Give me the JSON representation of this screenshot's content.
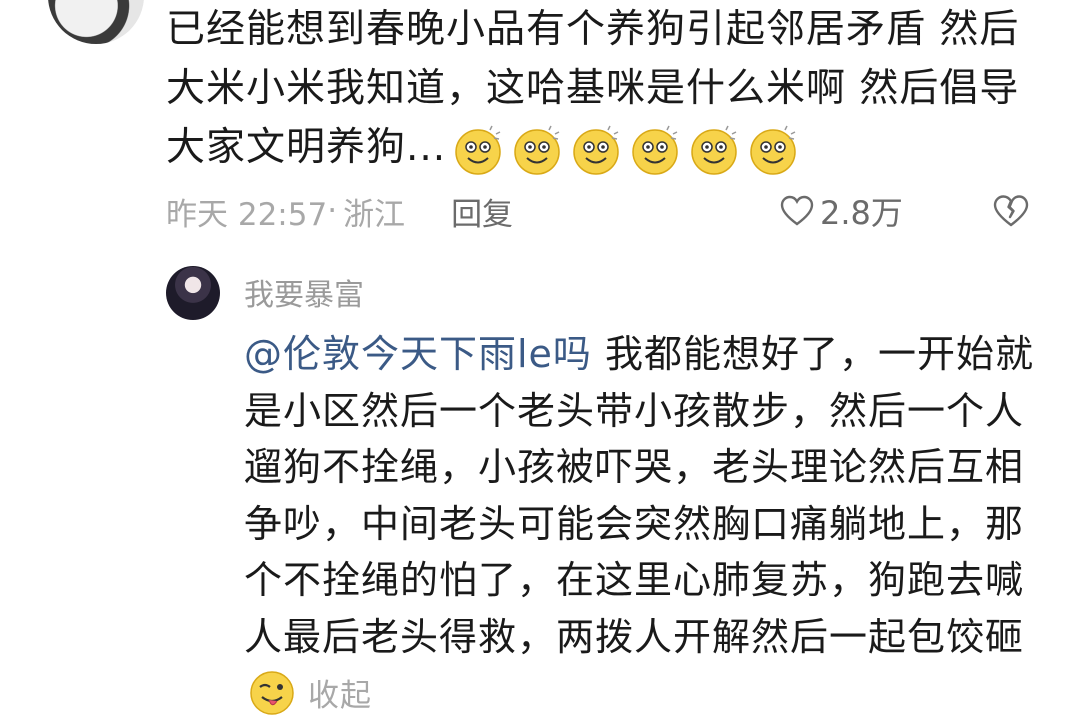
{
  "comment": {
    "text": "已经能想到春晚小品有个养狗引起邻居矛盾 然后 大米小米我知道，这哈基咪是什么米啊 然后倡导大家文明养狗...",
    "emoji_count": 6,
    "time": "昨天 22:57",
    "location_sep": "·",
    "location": "浙江",
    "reply_label": "回复",
    "likes": "2.8万"
  },
  "reply": {
    "username": "我要暴富",
    "mention": "@伦敦今天下雨le吗",
    "text": " 我都能想好了，一开始就是小区然后一个老头带小孩散步，然后一个人遛狗不拴绳，小孩被吓哭，老头理论然后互相争吵，中间老头可能会突然胸口痛躺地上，那个不拴绳的怕了，在这里心肺复苏，狗跑去喊人最后老头得救，两拨人开解然后一起包饺砸",
    "collapse_label": "收起"
  },
  "colors": {
    "mention": "#3b5a86",
    "meta": "#a8a8a8",
    "emoji_face": "#f7d34a"
  }
}
